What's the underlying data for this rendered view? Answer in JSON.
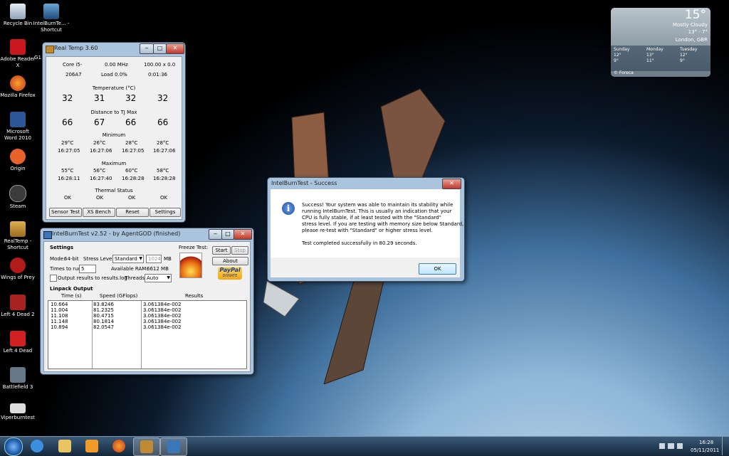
{
  "desktop_icons": [
    {
      "label": "Recycle Bin"
    },
    {
      "label": "IntelBurnTe... - Shortcut"
    },
    {
      "label": "Adobe Reader X"
    },
    {
      "label": "G1"
    },
    {
      "label": "Mozilla Firefox"
    },
    {
      "label": "Microsoft Word 2010"
    },
    {
      "label": "Origin"
    },
    {
      "label": "Steam"
    },
    {
      "label": "RealTemp - Shortcut"
    },
    {
      "label": "Wings of Prey"
    },
    {
      "label": "Left 4 Dead 2"
    },
    {
      "label": "Left 4 Dead"
    },
    {
      "label": "Battlefield 3"
    },
    {
      "label": "Viperburntest"
    }
  ],
  "weather": {
    "temp": "15°",
    "condition": "Mostly Cloudy",
    "range": "13° - 7°",
    "location": "London, GBR",
    "days": [
      {
        "name": "Sunday",
        "hi": "12°",
        "lo": "9°"
      },
      {
        "name": "Monday",
        "hi": "13°",
        "lo": "11°"
      },
      {
        "name": "Tuesday",
        "hi": "12°",
        "lo": "9°"
      }
    ],
    "source": "© Foreca"
  },
  "realtemp": {
    "title": "Real Temp 3.60",
    "cpu": "Core i5-",
    "mhz": "0.00 MHz",
    "mult": "100.00 x 0.0",
    "id": "206A7",
    "load": "Load  0.0%",
    "time": "0:01:36",
    "temp_header": "Temperature (°C)",
    "temps": [
      "32",
      "31",
      "32",
      "32"
    ],
    "tj_header": "Distance to TJ Max",
    "tj": [
      "66",
      "67",
      "66",
      "66"
    ],
    "min_header": "Minimum",
    "min_vals": [
      "29°C",
      "26°C",
      "28°C",
      "28°C"
    ],
    "min_times": [
      "16:27:05",
      "16:27:06",
      "16:27:05",
      "16:27:06"
    ],
    "max_header": "Maximum",
    "max_vals": [
      "55°C",
      "56°C",
      "60°C",
      "58°C"
    ],
    "max_times": [
      "16:28:11",
      "16:27:40",
      "16:28:28",
      "16:28:28"
    ],
    "thermal_header": "Thermal Status",
    "thermal": [
      "OK",
      "OK",
      "OK",
      "OK"
    ],
    "buttons": {
      "sensor": "Sensor Test",
      "xs": "XS Bench",
      "reset": "Reset",
      "settings": "Settings"
    }
  },
  "ibt": {
    "title": "IntelBurnTest v2.52 - by AgentGOD (finished)",
    "settings_label": "Settings",
    "mode_label": "Mode:",
    "mode_value": "64-bit",
    "stress_label": "Stress Level:",
    "stress_value": "Standard",
    "mem_value": "1024",
    "mem_unit": "MB",
    "times_label": "Times to run:",
    "times_value": "5",
    "avail_label": "Available RAM:",
    "avail_value": "6612 MB",
    "threads_label": "Threads:",
    "threads_value": "Auto",
    "log_label": "Output results to results.log",
    "freeze_label": "Freeze Test:",
    "start": "Start",
    "stop": "Stop",
    "about": "About",
    "paypal": "PayPal",
    "donate": "DONATE",
    "linpack_label": "Linpack Output",
    "col_time": "Time (s)",
    "col_speed": "Speed (GFlops)",
    "col_results": "Results",
    "rows": [
      {
        "time": "10.664",
        "speed": "83.8246",
        "result": "3.061384e-002"
      },
      {
        "time": "11.004",
        "speed": "81.2325",
        "result": "3.061384e-002"
      },
      {
        "time": "11.108",
        "speed": "80.4715",
        "result": "3.061384e-002"
      },
      {
        "time": "11.148",
        "speed": "80.1814",
        "result": "3.061384e-002"
      },
      {
        "time": "10.894",
        "speed": "82.0547",
        "result": "3.061384e-002"
      }
    ]
  },
  "dialog": {
    "title": "IntelBurnTest - Success",
    "line1": "Success! Your system was able to maintain its stability while",
    "line2": "running IntelBurnTest. This is usually an indication that your",
    "line3": "CPU is fully stable, if at least tested with the \"Standard\"",
    "line4": "stress level. If you are testing with memory size below Standard,",
    "line5": "please re-test with \"Standard\" or higher stress level.",
    "line6": "Test completed successfully in 80.29 seconds.",
    "ok": "OK"
  },
  "clock": {
    "time": "16:28",
    "date": "05/11/2011"
  }
}
